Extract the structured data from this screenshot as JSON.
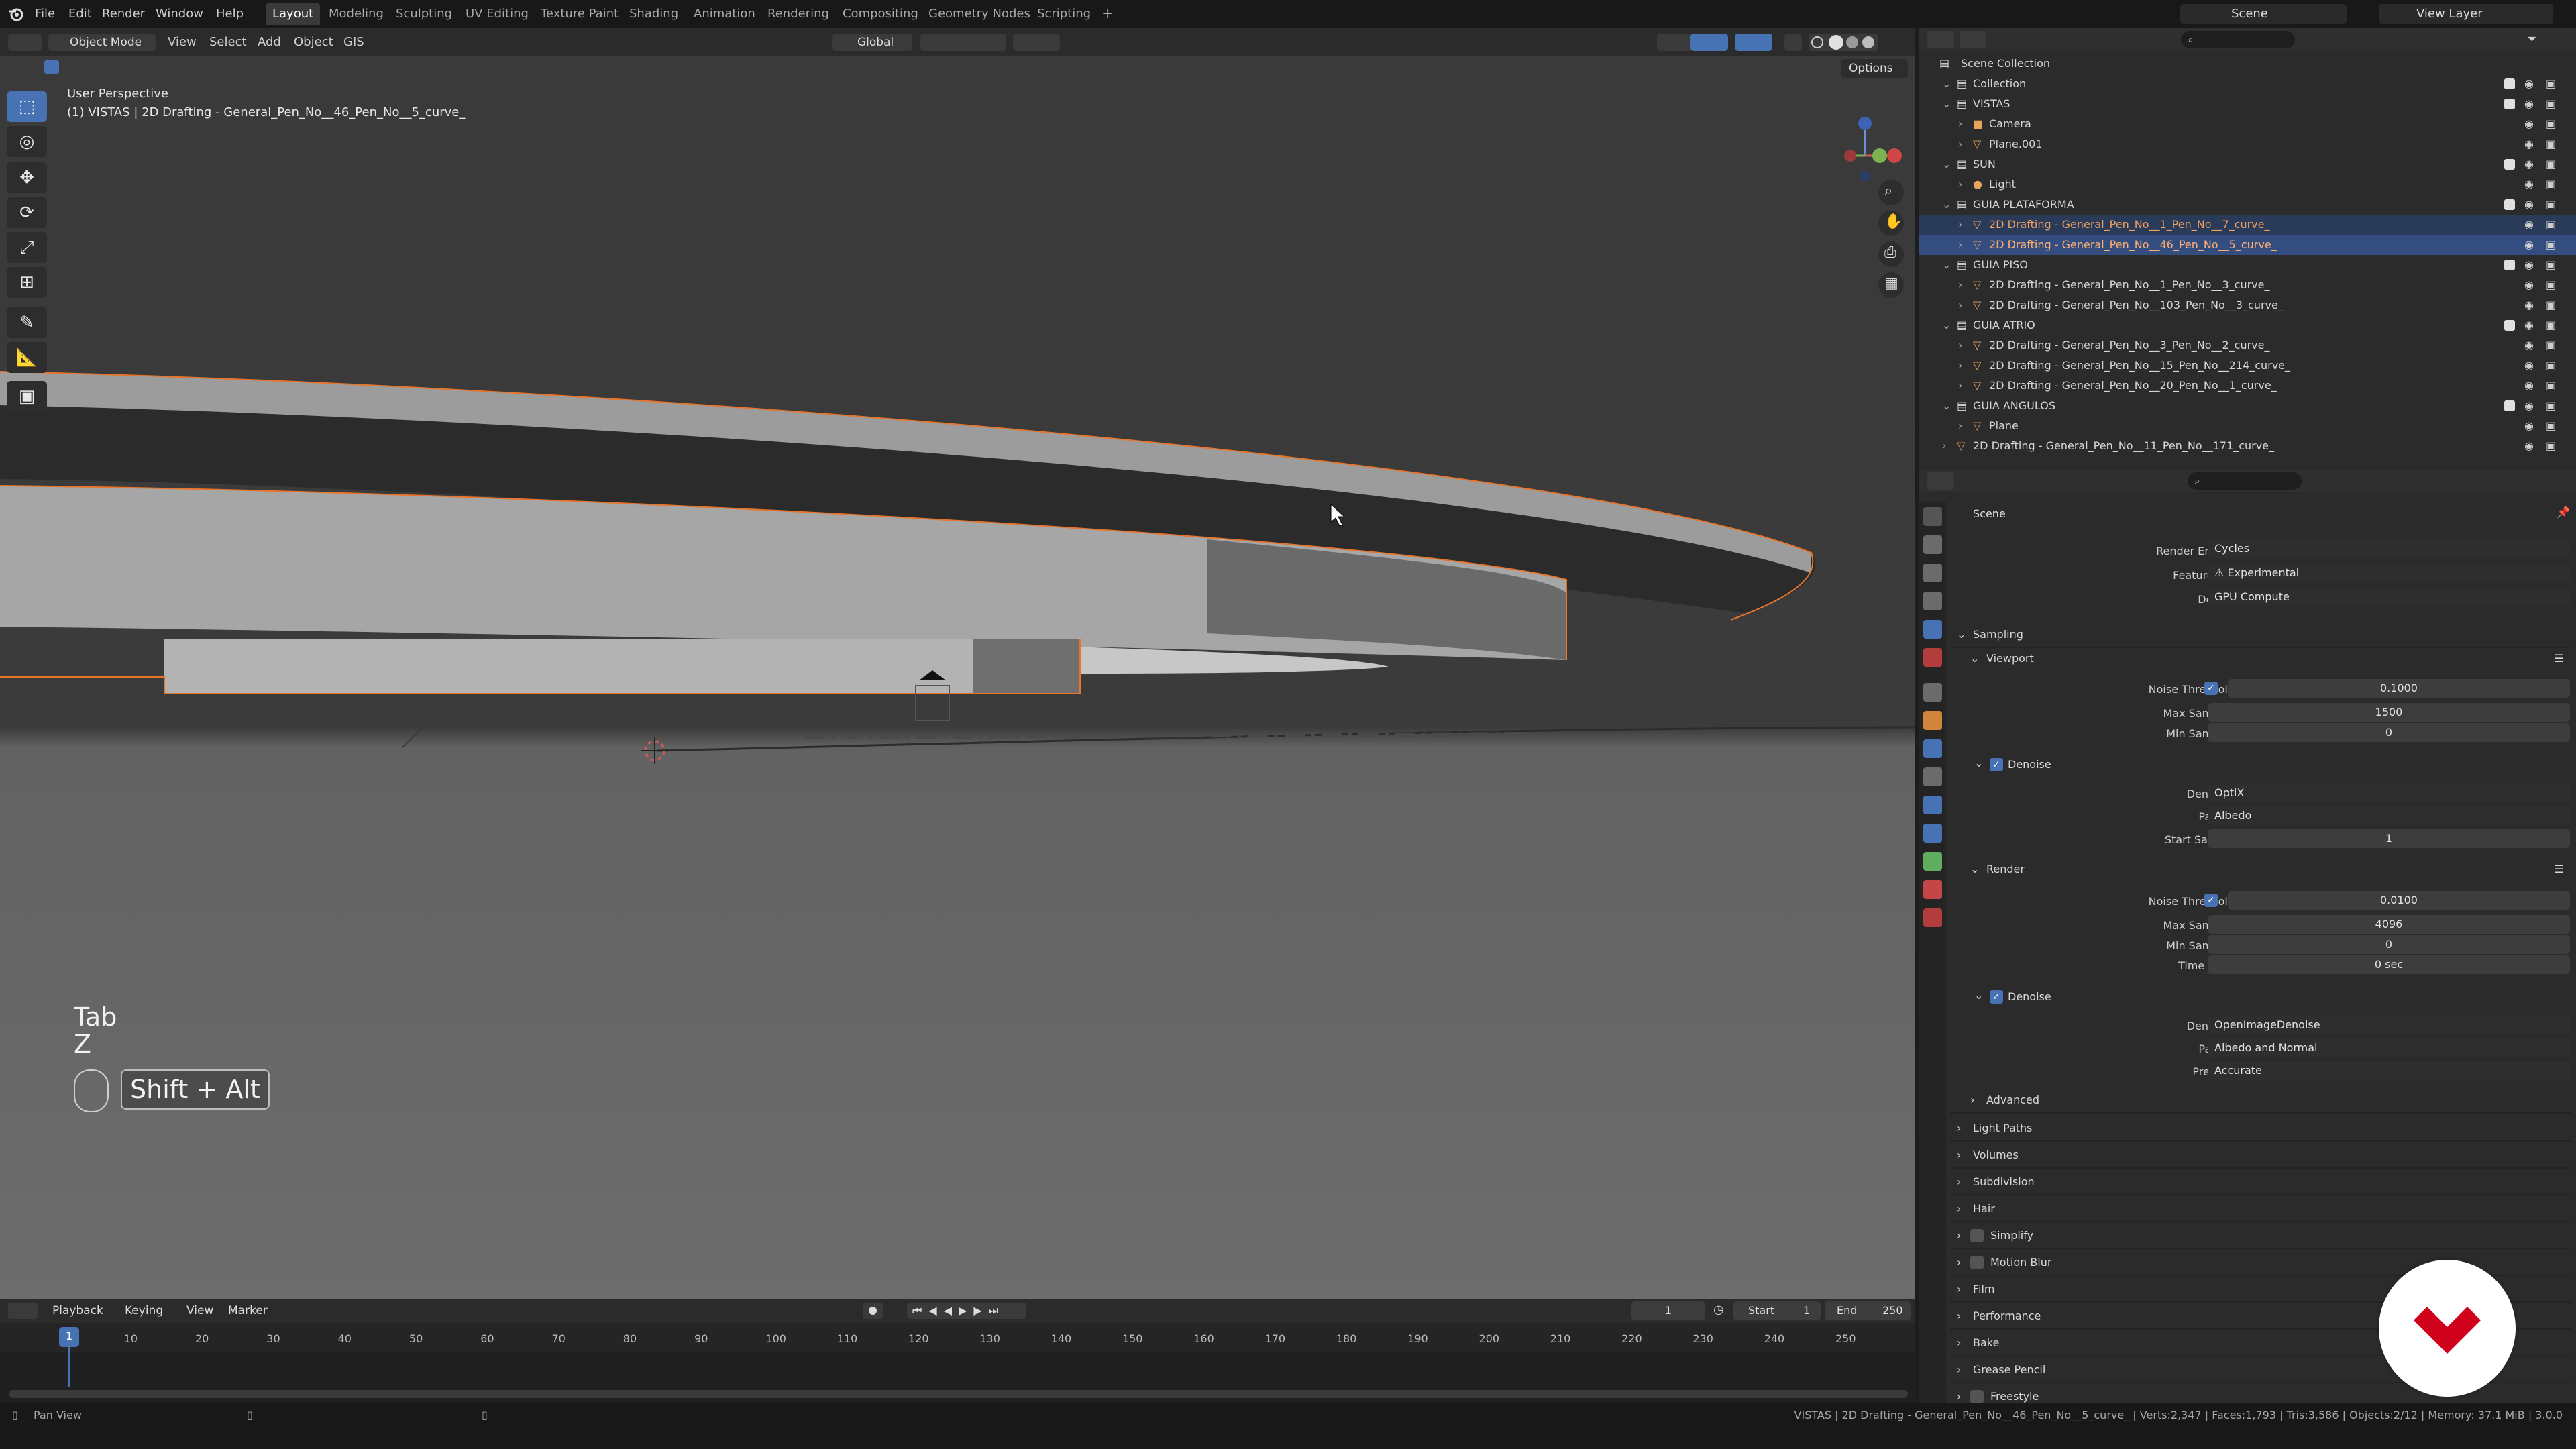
{
  "menubar": {
    "items": [
      "File",
      "Edit",
      "Render",
      "Window",
      "Help"
    ],
    "workspace_tabs": [
      "Layout",
      "Modeling",
      "Sculpting",
      "UV Editing",
      "Texture Paint",
      "Shading",
      "Animation",
      "Rendering",
      "Compositing",
      "Geometry Nodes",
      "Scripting"
    ],
    "add_tab": "+",
    "scene_label": "Scene",
    "view_layer_label": "View Layer"
  },
  "viewport_header": {
    "mode": "Object Mode",
    "menu": [
      "View",
      "Select",
      "Add",
      "Object",
      "GIS"
    ],
    "transform_orientation": "Global",
    "options": "Options"
  },
  "viewport": {
    "perspective": "User Perspective",
    "active_object": "(1) VISTAS | 2D Drafting - General_Pen_No__46_Pen_No__5_curve_",
    "key_hint_1": "Tab",
    "key_hint_2": "Z",
    "key_combo": "Shift + Alt"
  },
  "outliner": {
    "root": "Scene Collection",
    "rows": [
      {
        "label": "Collection",
        "indent": 1,
        "type": "collection"
      },
      {
        "label": "VISTAS",
        "indent": 1,
        "type": "collection"
      },
      {
        "label": "Camera",
        "indent": 2,
        "type": "camera"
      },
      {
        "label": "Plane.001",
        "indent": 2,
        "type": "mesh"
      },
      {
        "label": "SUN",
        "indent": 1,
        "type": "collection"
      },
      {
        "label": "Light",
        "indent": 2,
        "type": "light"
      },
      {
        "label": "GUIA PLATAFORMA",
        "indent": 1,
        "type": "collection"
      },
      {
        "label": "2D Drafting - General_Pen_No__1_Pen_No__7_curve_",
        "indent": 2,
        "type": "curve",
        "selected": "sel2"
      },
      {
        "label": "2D Drafting - General_Pen_No__46_Pen_No__5_curve_",
        "indent": 2,
        "type": "curve",
        "selected": "sel"
      },
      {
        "label": "GUIA PISO",
        "indent": 1,
        "type": "collection"
      },
      {
        "label": "2D Drafting - General_Pen_No__1_Pen_No__3_curve_",
        "indent": 2,
        "type": "curve"
      },
      {
        "label": "2D Drafting - General_Pen_No__103_Pen_No__3_curve_",
        "indent": 2,
        "type": "curve"
      },
      {
        "label": "GUIA ATRIO",
        "indent": 1,
        "type": "collection"
      },
      {
        "label": "2D Drafting - General_Pen_No__3_Pen_No__2_curve_",
        "indent": 2,
        "type": "curve"
      },
      {
        "label": "2D Drafting - General_Pen_No__15_Pen_No__214_curve_",
        "indent": 2,
        "type": "curve"
      },
      {
        "label": "2D Drafting - General_Pen_No__20_Pen_No__1_curve_",
        "indent": 2,
        "type": "curve"
      },
      {
        "label": "GUIA ANGULOS",
        "indent": 1,
        "type": "collection"
      },
      {
        "label": "Plane",
        "indent": 2,
        "type": "mesh"
      },
      {
        "label": "2D Drafting - General_Pen_No__11_Pen_No__171_curve_",
        "indent": 1,
        "type": "curve"
      }
    ]
  },
  "properties": {
    "context": "Scene",
    "render_engine_label": "Render Engine",
    "render_engine": "Cycles",
    "feature_set_label": "Feature Set",
    "feature_set": "Experimental",
    "device_label": "Device",
    "device": "GPU Compute",
    "sampling": "Sampling",
    "viewport_sub": "Viewport",
    "noise_threshold_label": "Noise Threshold",
    "vp_noise_threshold": "0.1000",
    "max_samples_label": "Max Samples",
    "vp_max_samples": "1500",
    "min_samples_label": "Min Samples",
    "vp_min_samples": "0",
    "denoise_label": "Denoise",
    "denoiser_label": "Denoiser",
    "vp_denoiser": "OptiX",
    "passes_label": "Passes",
    "vp_passes": "Albedo",
    "start_sample_label": "Start Sample",
    "vp_start_sample": "1",
    "render_sub": "Render",
    "r_noise_threshold": "0.0100",
    "r_max_samples": "4096",
    "r_min_samples": "0",
    "time_limit_label": "Time Limit",
    "r_time_limit": "0 sec",
    "r_denoiser": "OpenImageDenoise",
    "r_passes": "Albedo and Normal",
    "prefilter_label": "Prefilter",
    "r_prefilter": "Accurate",
    "advanced": "Advanced",
    "sections": [
      "Light Paths",
      "Volumes",
      "Subdivision",
      "Hair",
      "Simplify",
      "Motion Blur",
      "Film",
      "Performance",
      "Bake",
      "Grease Pencil",
      "Freestyle"
    ]
  },
  "timeline": {
    "menu": [
      "Playback",
      "Keying",
      "View",
      "Marker"
    ],
    "current_frame": "1",
    "start_label": "Start",
    "start": "1",
    "end_label": "End",
    "end": "250",
    "ticks": [
      "1",
      "10",
      "20",
      "30",
      "40",
      "50",
      "60",
      "70",
      "80",
      "90",
      "100",
      "110",
      "120",
      "130",
      "140",
      "150",
      "160",
      "170",
      "180",
      "190",
      "200",
      "210",
      "220",
      "230",
      "240",
      "250"
    ]
  },
  "statusbar": {
    "left": "Pan View",
    "right": "VISTAS | 2D Drafting - General_Pen_No__46_Pen_No__5_curve_ | Verts:2,347 | Faces:1,793 | Tris:3,586 | Objects:2/12 | Memory: 37.1 MiB | 3.0.0"
  },
  "colors": {
    "accent": "#4772b3",
    "selection_outline": "#e8742b",
    "brand_logo": "#d0021b"
  }
}
